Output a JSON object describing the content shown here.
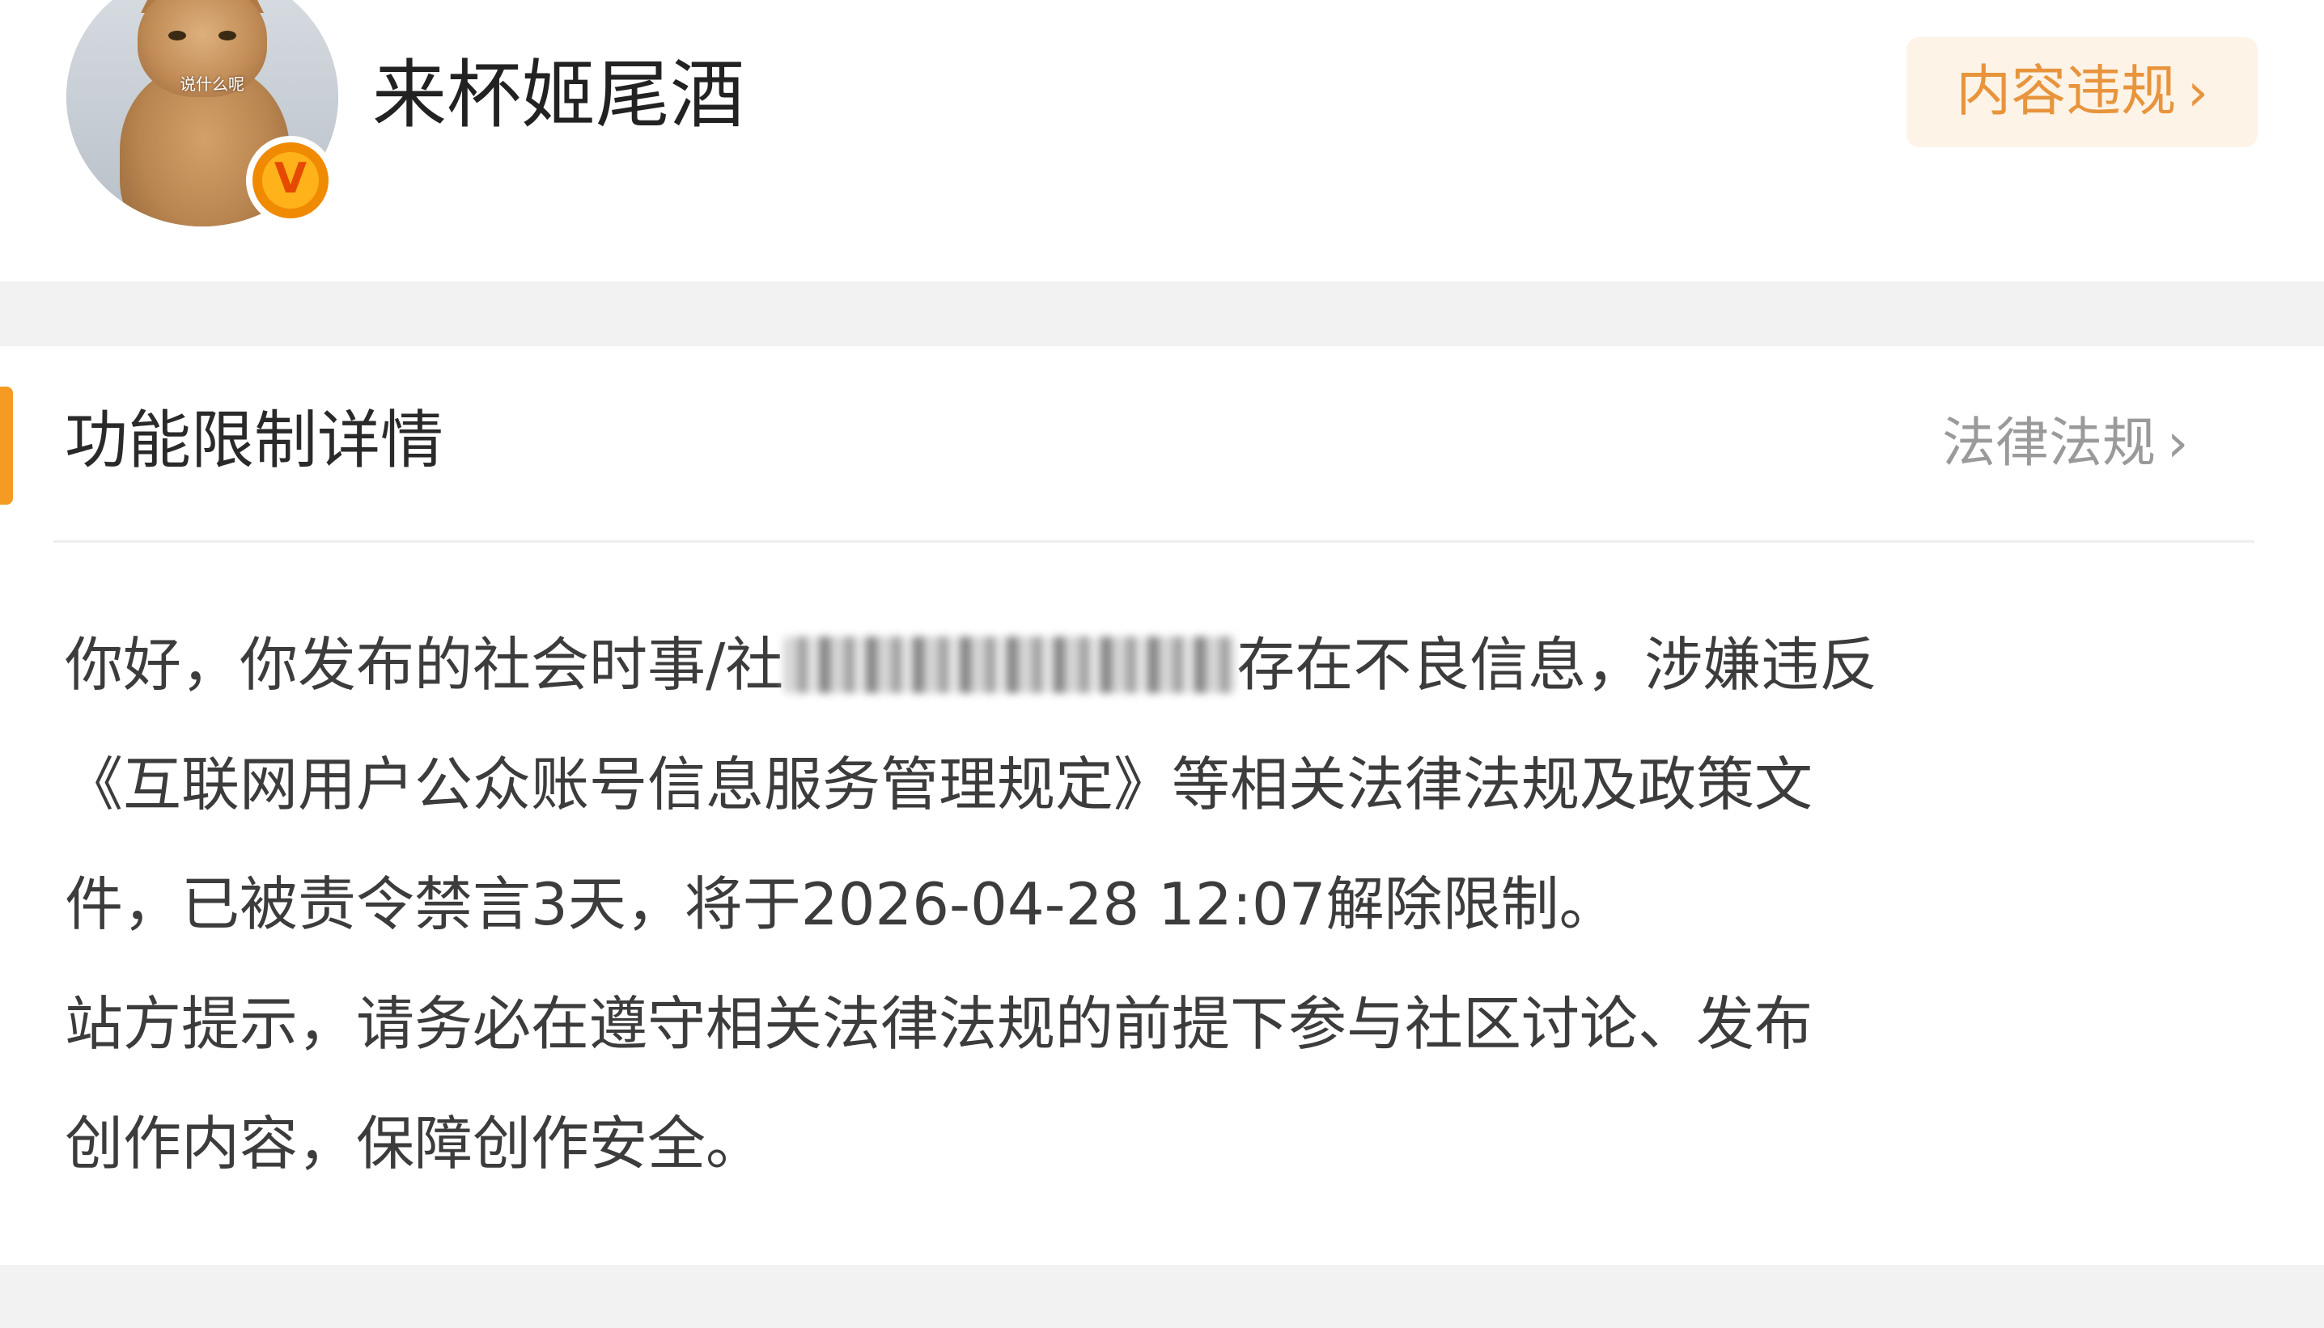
{
  "profile": {
    "username": "来杯姬尾酒",
    "avatar_caption": "说什么呢",
    "verified_mark": "V",
    "violation_button_label": "内容违规",
    "violation_button_chevron": "›"
  },
  "detail": {
    "title": "功能限制详情",
    "law_link_label": "法律法规",
    "law_link_chevron": "›",
    "notice_lines": {
      "line1_before_redaction": "你好，你发布的社会时事/社",
      "line1_after_redaction": "存在不良信息，涉嫌违反",
      "line2": "《互联网用户公众账号信息服务管理规定》等相关法律法规及政策文",
      "line3": "件，已被责令禁言3天，将于2026-04-28 12:07解除限制。",
      "line4": "站方提示，请务必在遵守相关法律法规的前提下参与社区讨论、发布",
      "line5": "创作内容，保障创作安全。"
    }
  },
  "colors": {
    "accent_orange": "#f59a23",
    "violation_text": "#e8943c",
    "violation_bg": "#fdf3e6",
    "verified_badge": "#f08a00",
    "body_text": "#3c3c3c",
    "muted_text": "#9a9a9a",
    "page_bg": "#f2f2f2"
  }
}
